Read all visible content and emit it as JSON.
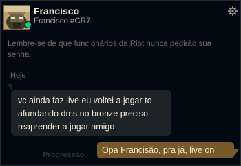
{
  "header": {
    "name": "Francisco",
    "tag": "Francisco #CR7",
    "status": "online",
    "minimize_icon": "minimize-icon",
    "settings_icon": "gear-icon"
  },
  "notice": "Lembre-se de que funcionários da Riot nunca pedirão sua senha.",
  "day_separator": "Hoje",
  "messages": [
    {
      "direction": "incoming",
      "text": "vc ainda faz live eu voltei a jogar to afundando dms no bronze preciso reaprender a jogar amigo"
    },
    {
      "direction": "outgoing",
      "text": "Opa Francisão, pra já, live on"
    }
  ],
  "background_label": "Progressão",
  "colors": {
    "background": "#010a13",
    "incoming_bubble": "#1e2328",
    "outgoing_bubble": "#785a28",
    "text_primary": "#f0e6d2",
    "text_muted": "#6e6a60",
    "status_online": "#0acf83"
  }
}
